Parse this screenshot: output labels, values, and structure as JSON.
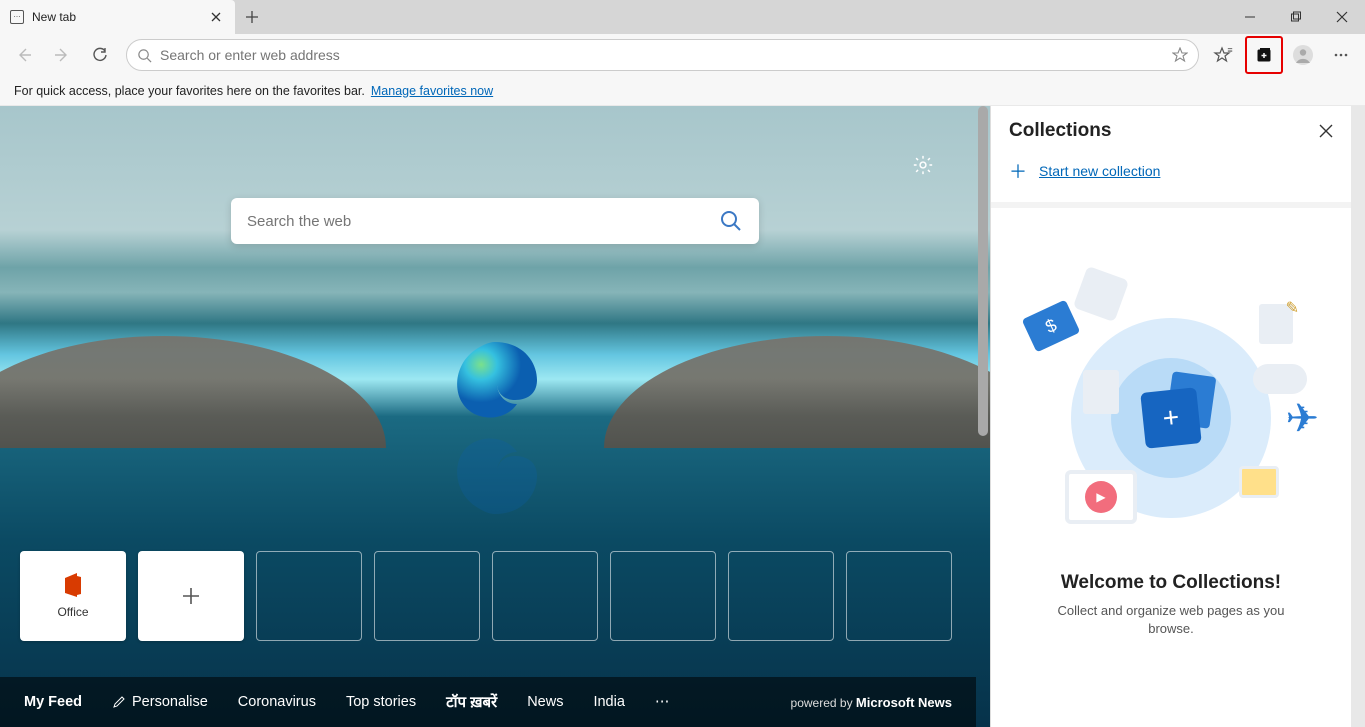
{
  "tab": {
    "title": "New tab"
  },
  "toolbar": {
    "address_placeholder": "Search or enter web address"
  },
  "favbar": {
    "hint": "For quick access, place your favorites here on the favorites bar.",
    "manage_link": "Manage favorites now"
  },
  "ntp": {
    "search_placeholder": "Search the web",
    "tiles": [
      {
        "label": "Office",
        "kind": "office"
      },
      {
        "label": "",
        "kind": "add"
      },
      {
        "label": "",
        "kind": "empty"
      },
      {
        "label": "",
        "kind": "empty"
      },
      {
        "label": "",
        "kind": "empty"
      },
      {
        "label": "",
        "kind": "empty"
      },
      {
        "label": "",
        "kind": "empty"
      },
      {
        "label": "",
        "kind": "empty"
      }
    ],
    "feed": {
      "myfeed": "My Feed",
      "personalise": "Personalise",
      "items": [
        "Coronavirus",
        "Top stories",
        "टॉप ख़बरें",
        "News",
        "India"
      ],
      "powered_prefix": "powered by",
      "powered_brand": "Microsoft News"
    }
  },
  "collections": {
    "title": "Collections",
    "start_new": "Start new collection",
    "welcome_title": "Welcome to Collections!",
    "welcome_text": "Collect and organize web pages as you browse."
  }
}
